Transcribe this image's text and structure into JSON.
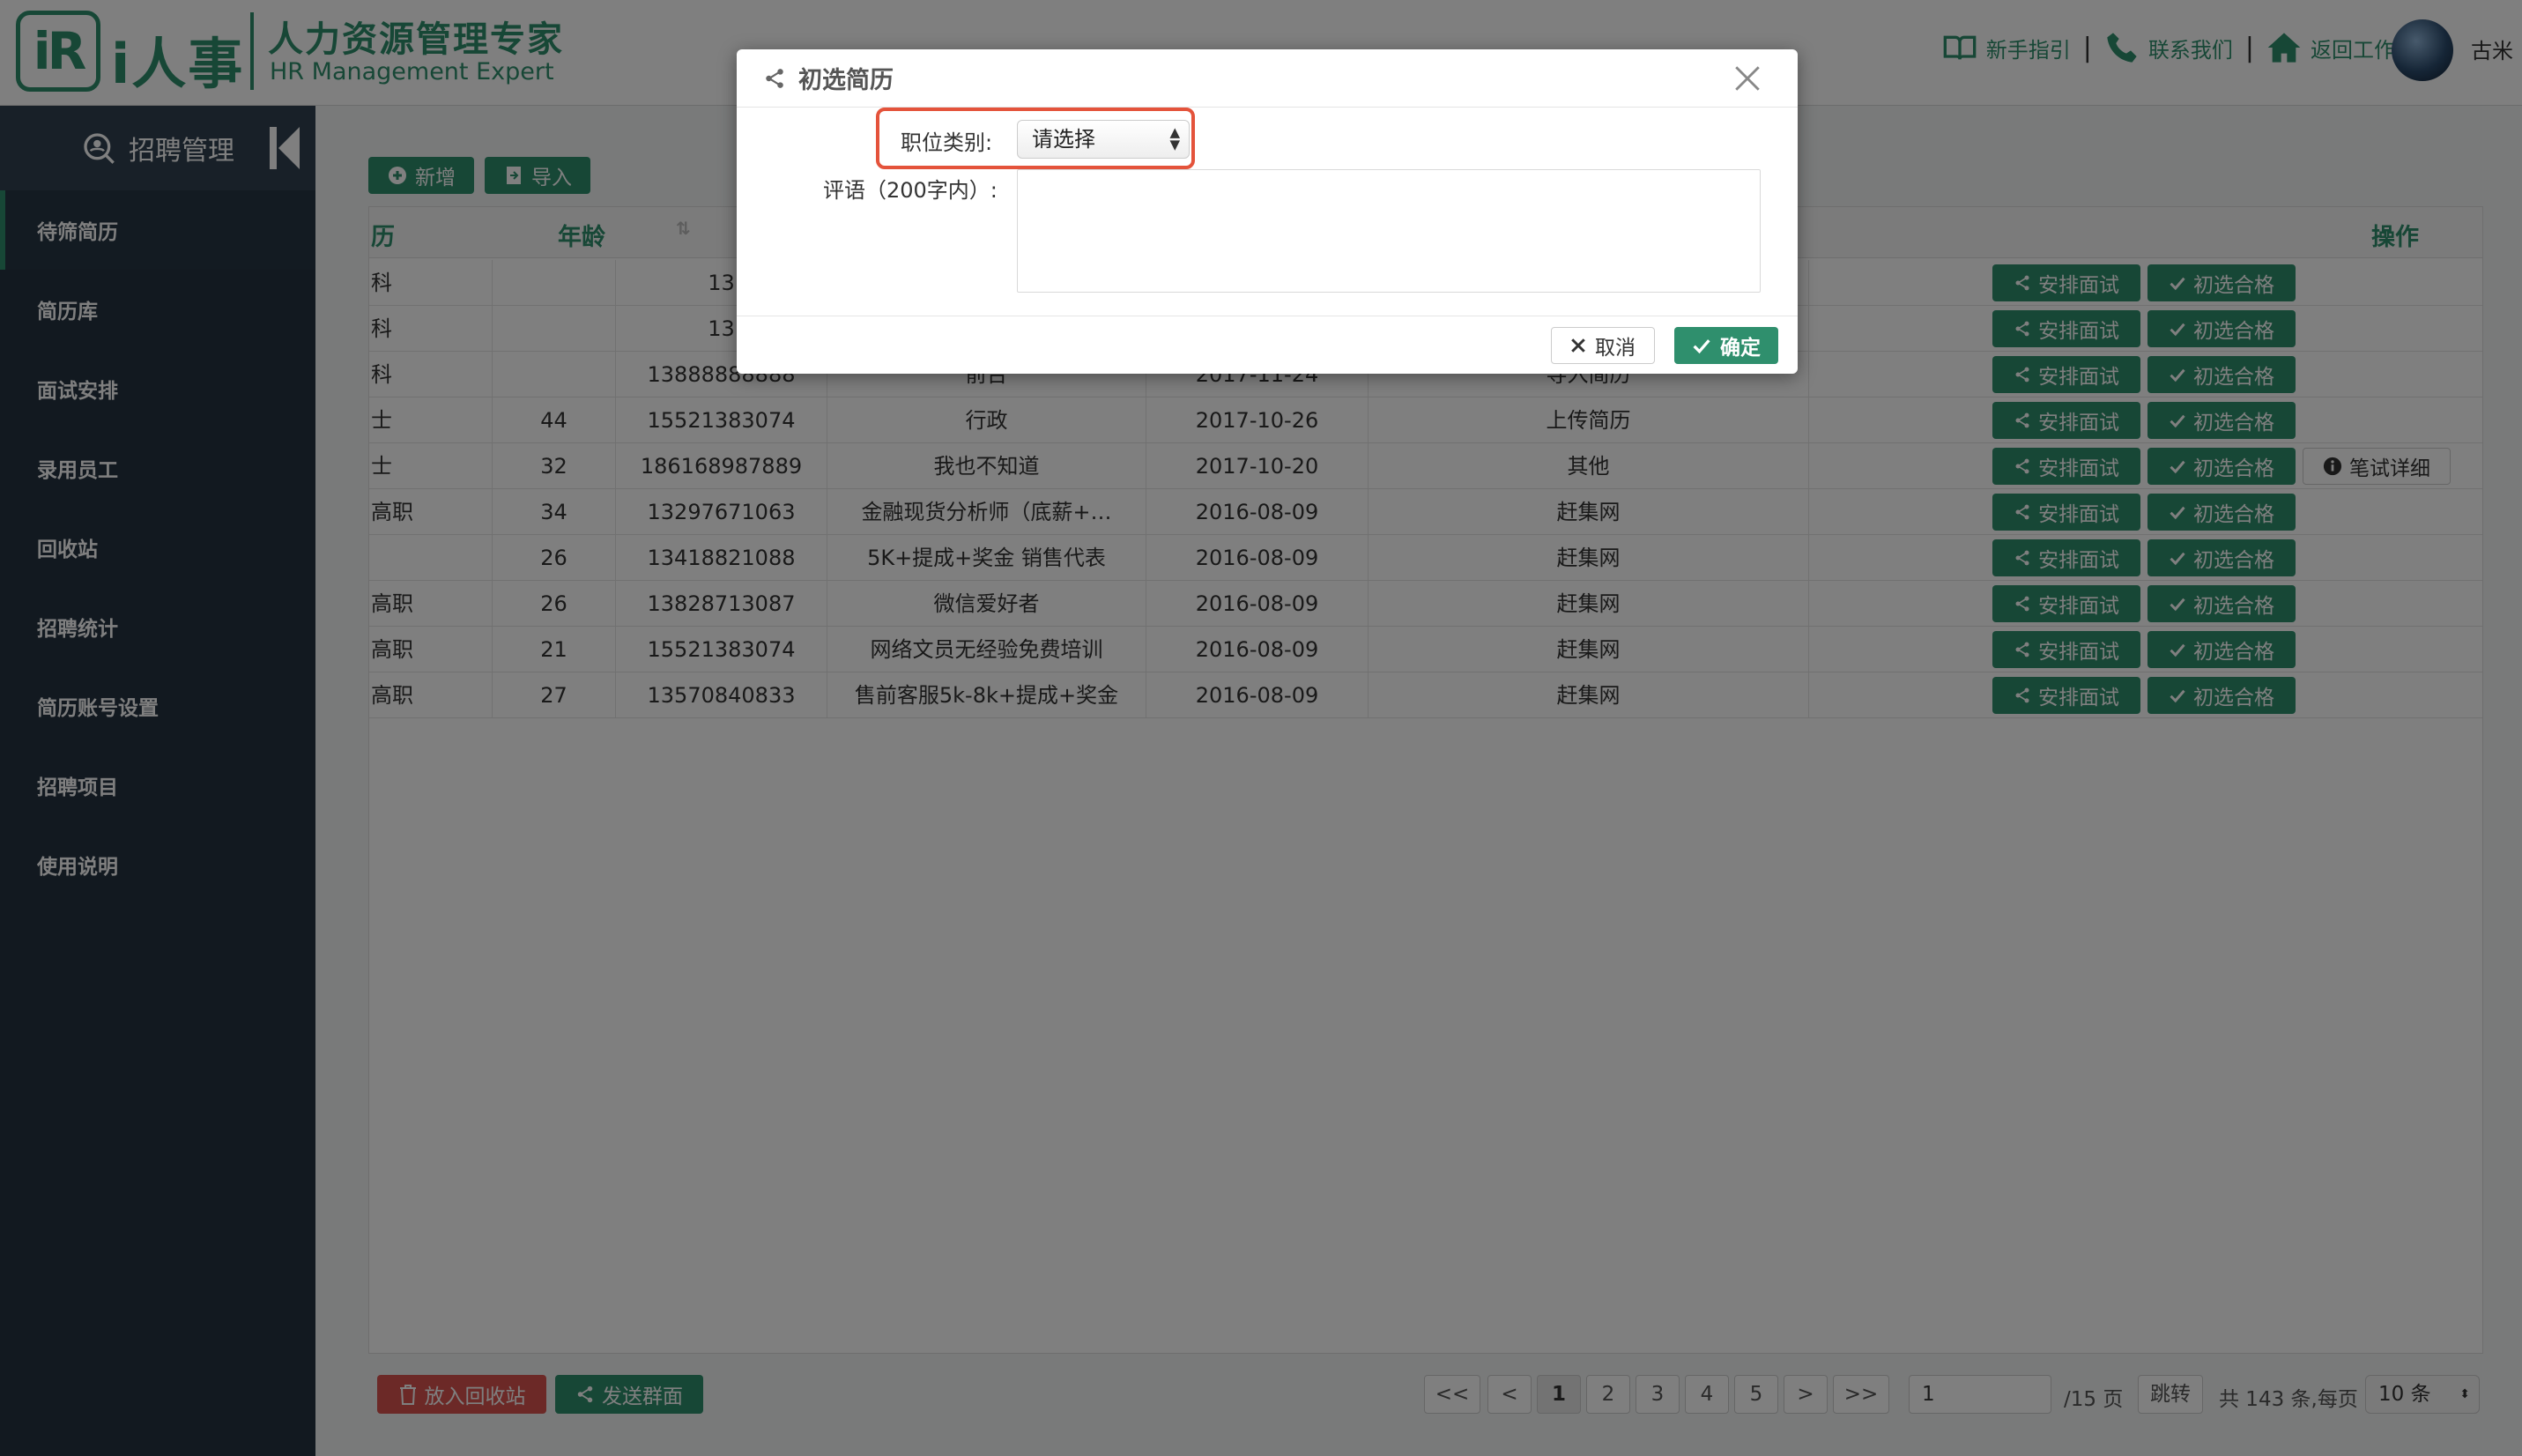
{
  "header": {
    "logo_mark": "iR",
    "logo_name": "i人事",
    "logo_cn": "人力资源管理专家",
    "logo_en": "HR Management Expert",
    "links": [
      "新手指引",
      "联系我们",
      "返回工作台"
    ],
    "username": "古米"
  },
  "sidebar": {
    "title": "招聘管理",
    "items": [
      "待筛简历",
      "简历库",
      "面试安排",
      "录用员工",
      "回收站",
      "招聘统计",
      "简历账号设置",
      "招聘项目",
      "使用说明"
    ],
    "active_index": 0
  },
  "toolbar": {
    "add_label": "新增",
    "import_label": "导入"
  },
  "table": {
    "headers": {
      "edu": "历",
      "age": "年龄",
      "ops": "操作"
    },
    "rows": [
      {
        "edu": "科",
        "age": "",
        "phone": "13",
        "position": "",
        "date": "",
        "source": ""
      },
      {
        "edu": "科",
        "age": "",
        "phone": "13",
        "position": "",
        "date": "",
        "source": ""
      },
      {
        "edu": "科",
        "age": "",
        "phone": "13888888888",
        "position": "前台",
        "date": "2017-11-24",
        "source": "导入简历"
      },
      {
        "edu": "士",
        "age": "44",
        "phone": "15521383074",
        "position": "行政",
        "date": "2017-10-26",
        "source": "上传简历"
      },
      {
        "edu": "士",
        "age": "32",
        "phone": "186168987889",
        "position": "我也不知道",
        "date": "2017-10-20",
        "source": "其他"
      },
      {
        "edu": "高职",
        "age": "34",
        "phone": "13297671063",
        "position": "金融现货分析师（底薪+…",
        "date": "2016-08-09",
        "source": "赶集网"
      },
      {
        "edu": "",
        "age": "26",
        "phone": "13418821088",
        "position": "5K+提成+奖金 销售代表",
        "date": "2016-08-09",
        "source": "赶集网"
      },
      {
        "edu": "高职",
        "age": "26",
        "phone": "13828713087",
        "position": "微信爱好者",
        "date": "2016-08-09",
        "source": "赶集网"
      },
      {
        "edu": "高职",
        "age": "21",
        "phone": "15521383074",
        "position": "网络文员无经验免费培训",
        "date": "2016-08-09",
        "source": "赶集网"
      },
      {
        "edu": "高职",
        "age": "27",
        "phone": "13570840833",
        "position": "售前客服5k-8k+提成+奖金",
        "date": "2016-08-09",
        "source": "赶集网"
      }
    ],
    "btn_interview": "安排面试",
    "btn_pass": "初选合格",
    "btn_exam_detail": "笔试详细"
  },
  "footer": {
    "recycle_label": "放入回收站",
    "group_label": "发送群面",
    "pages": [
      "<<",
      "<",
      "1",
      "2",
      "3",
      "4",
      "5",
      ">",
      ">>"
    ],
    "current_page": "1",
    "goto_value": "1",
    "total_pages": "/15 页",
    "jump_label": "跳转",
    "summary": "共 143 条,每页",
    "page_size": "10 条"
  },
  "modal": {
    "title": "初选简历",
    "category_label": "职位类别:",
    "category_value": "请选择",
    "comment_label": "评语（200字内）:",
    "comment_value": "",
    "cancel_label": "取消",
    "ok_label": "确定"
  },
  "colors": {
    "brand": "#2f8f6d",
    "danger": "#d9534f",
    "highlight": "#e4533b",
    "sidebar": "#243341"
  }
}
